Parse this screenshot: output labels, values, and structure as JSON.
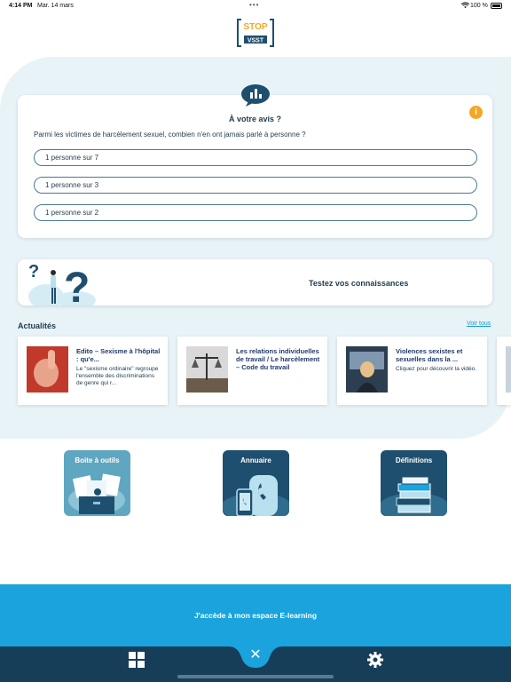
{
  "status": {
    "time": "4:14 PM",
    "date": "Mar. 14 mars",
    "dots": "•••",
    "battery": "100 %"
  },
  "logo": {
    "top": "STOP",
    "bottom": "VSST"
  },
  "poll": {
    "title": "À votre avis ?",
    "question": "Parmi les victimes de harcèlement sexuel, combien n'en ont jamais parlé à personne ?",
    "info": "i",
    "options": [
      "1 personne sur 7",
      "1 personne sur 3",
      "1 personne sur 2"
    ]
  },
  "quiz": {
    "label": "Testez vos connaissances"
  },
  "news": {
    "header": "Actualités",
    "see_all": "Voir tous",
    "items": [
      {
        "title": "Edito – Sexisme à l'hôpital : qu'e...",
        "desc": "Le \"sexisme ordinaire\" regroupe l'ensemble des discriminations de genre qui r..."
      },
      {
        "title": "Les relations individuelles de travail / Le harcèlement – Code du travail",
        "desc": ""
      },
      {
        "title": "Violences sexistes et sexuelles dans la ...",
        "desc": "Cliquez pour découvrir la vidéo."
      }
    ]
  },
  "tiles": [
    {
      "label": "Boite à outils"
    },
    {
      "label": "Annuaire"
    },
    {
      "label": "Définitions"
    }
  ],
  "elearning": {
    "label": "J'accède à mon espace E-learning"
  },
  "tabbar": {
    "close": "✕"
  },
  "colors": {
    "accent": "#1aa3dc",
    "navy": "#173e58",
    "info": "#f5a623",
    "light_bg": "#e8f3f8"
  }
}
